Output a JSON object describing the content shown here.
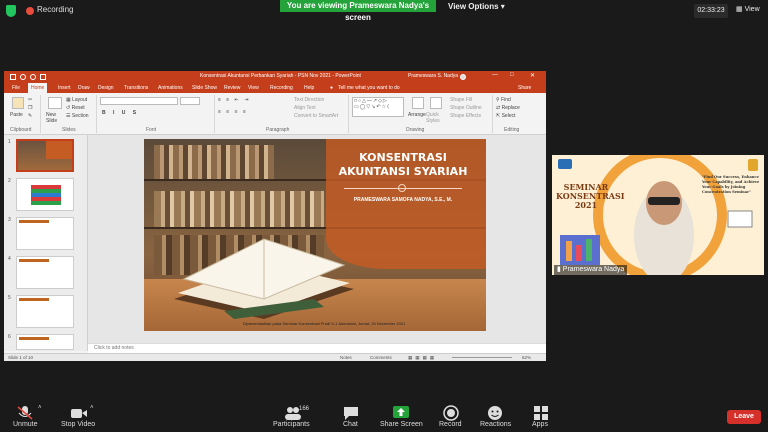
{
  "zoom_bar": {
    "recording_label": "Recording",
    "viewing_banner": "You are viewing Prameswara Nadya's screen",
    "view_options_label": "View Options",
    "clock": "02:33:23",
    "view_label": "View"
  },
  "ppt": {
    "title": "Konsentrasi Akuntansi Perbankan Syariah - PSN Nov 2021  -  PowerPoint",
    "user": "Prameswara S. Nadya",
    "menu": [
      "File",
      "Home",
      "Insert",
      "Draw",
      "Design",
      "Transitions",
      "Animations",
      "Slide Show",
      "Review",
      "View",
      "Recording",
      "Help"
    ],
    "tell_me": "Tell me what you want to do",
    "share": "Share",
    "ribbon": {
      "paste": "Paste",
      "new_slide": "New Slide",
      "layout": "Layout",
      "reset": "Reset",
      "section": "Section",
      "text_direction": "Text Direction",
      "align_text": "Align Text",
      "convert_smartart": "Convert to SmartArt",
      "arrange": "Arrange",
      "quick_styles": "Quick Styles",
      "shape_fill": "Shape Fill",
      "shape_outline": "Shape Outline",
      "shape_effects": "Shape Effects",
      "find": "Find",
      "replace": "Replace",
      "select": "Select",
      "groups": [
        "Clipboard",
        "Slides",
        "Font",
        "Paragraph",
        "Drawing",
        "Editing"
      ]
    },
    "thumbnail_numbers": [
      "1",
      "2",
      "3",
      "4",
      "5",
      "6"
    ],
    "slide": {
      "title_line1": "KONSENTRASI",
      "title_line2": "AKUNTANSI SYARIAH",
      "author": "PRAMESWARA SAMOFA NADYA, S.E., M.",
      "footer": "Dipresentasikan pada Seminar Konsentrasi Prodi S-1 Akuntansi, Jumat, 26 November 2021"
    },
    "notes_placeholder": "Click to add notes",
    "status": {
      "slide_count": "Slide 1 of 10",
      "notes": "Notes",
      "comments": "Comments",
      "zoom": "62%"
    }
  },
  "video": {
    "participant_name": "Prameswara Nadya",
    "banner_line1": "SEMINAR",
    "banner_line2": "KONSENTRASI",
    "banner_year": "2021",
    "quote": "\"Find Our Success, Enhance Your Capability, and Achieve Your Goals by Joining Concentration Seminar\""
  },
  "toolbar": {
    "unmute": "Unmute",
    "stop_video": "Stop Video",
    "participants": "Participants",
    "participants_count": "166",
    "chat": "Chat",
    "share_screen": "Share Screen",
    "record": "Record",
    "reactions": "Reactions",
    "apps": "Apps",
    "leave": "Leave"
  },
  "colors": {
    "ppt_accent": "#c43e1c",
    "zoom_green": "#23a33a",
    "leave_red": "#d6302b"
  }
}
